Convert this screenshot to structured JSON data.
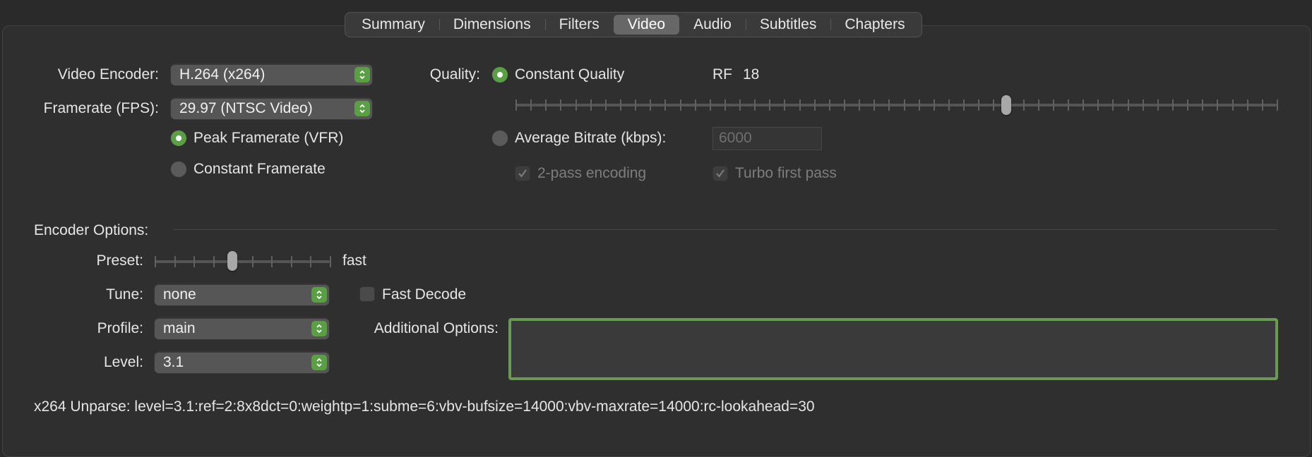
{
  "tabs": [
    "Summary",
    "Dimensions",
    "Filters",
    "Video",
    "Audio",
    "Subtitles",
    "Chapters"
  ],
  "active_tab": "Video",
  "video": {
    "encoder_label": "Video Encoder:",
    "encoder_value": "H.264 (x264)",
    "framerate_label": "Framerate (FPS):",
    "framerate_value": "29.97 (NTSC Video)",
    "peak_framerate_label": "Peak Framerate (VFR)",
    "peak_framerate_selected": true,
    "constant_framerate_label": "Constant Framerate",
    "constant_framerate_selected": false
  },
  "quality": {
    "label": "Quality:",
    "constant_quality_label": "Constant Quality",
    "constant_quality_selected": true,
    "rf_label": "RF",
    "rf_value": "18",
    "rf_slider_fraction": 0.645,
    "average_bitrate_label": "Average Bitrate (kbps):",
    "average_bitrate_selected": false,
    "bitrate_value": "6000",
    "two_pass_label": "2-pass encoding",
    "two_pass_checked": true,
    "turbo_label": "Turbo first pass",
    "turbo_checked": true
  },
  "encoder_options": {
    "section_label": "Encoder Options:",
    "preset_label": "Preset:",
    "preset_value": "fast",
    "preset_slider_fraction": 0.444,
    "tune_label": "Tune:",
    "tune_value": "none",
    "fast_decode_label": "Fast Decode",
    "fast_decode_checked": false,
    "profile_label": "Profile:",
    "profile_value": "main",
    "level_label": "Level:",
    "level_value": "3.1",
    "additional_options_label": "Additional Options:",
    "additional_options_value": ""
  },
  "unparse_text": "x264 Unparse: level=3.1:ref=2:8x8dct=0:weightp=1:subme=6:vbv-bufsize=14000:vbv-maxrate=14000:rc-lookahead=30",
  "colors": {
    "accent": "#5a9e46",
    "focus_ring": "#6a9a55",
    "background": "#2a2a2a"
  }
}
